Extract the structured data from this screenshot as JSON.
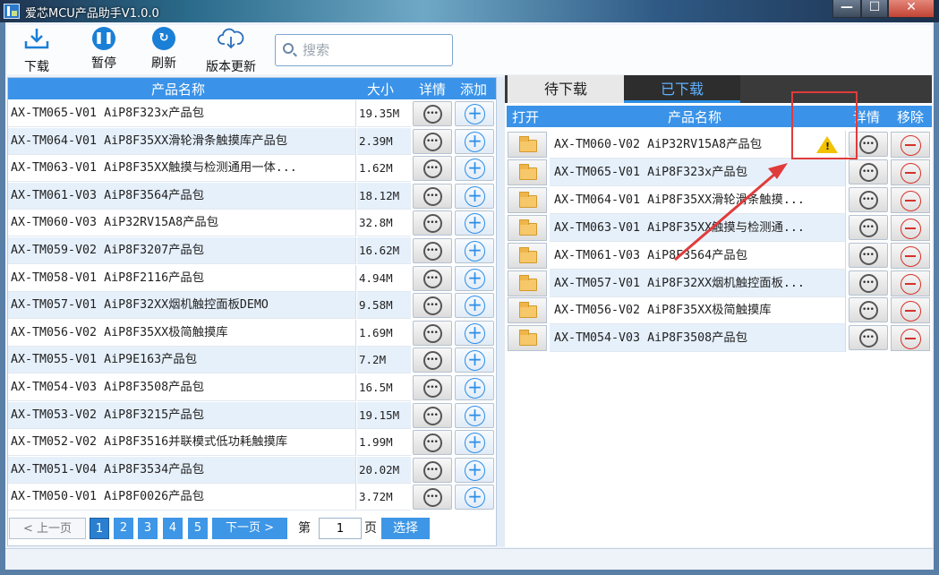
{
  "window": {
    "title": "爱芯MCU产品助手V1.0.0",
    "min": "—",
    "max": "☐",
    "close": "✕"
  },
  "toolbar": {
    "download": "下载",
    "pause": "暂停",
    "refresh": "刷新",
    "update": "版本更新",
    "search_placeholder": "搜索"
  },
  "left_table": {
    "headers": {
      "name": "产品名称",
      "size": "大小",
      "detail": "详情",
      "add": "添加"
    },
    "rows": [
      {
        "name": "AX-TM065-V01 AiP8F323x产品包",
        "size": "19.35M"
      },
      {
        "name": "AX-TM064-V01 AiP8F35XX滑轮滑条触摸库产品包",
        "size": "2.39M"
      },
      {
        "name": "AX-TM063-V01 AiP8F35XX触摸与检测通用一体...",
        "size": "1.62M"
      },
      {
        "name": "AX-TM061-V03 AiP8F3564产品包",
        "size": "18.12M"
      },
      {
        "name": "AX-TM060-V03 AiP32RV15A8产品包",
        "size": "32.8M"
      },
      {
        "name": "AX-TM059-V02 AiP8F3207产品包",
        "size": "16.62M"
      },
      {
        "name": "AX-TM058-V01 AiP8F2116产品包",
        "size": "4.94M"
      },
      {
        "name": "AX-TM057-V01 AiP8F32XX烟机触控面板DEMO",
        "size": "9.58M"
      },
      {
        "name": "AX-TM056-V02 AiP8F35XX极简触摸库",
        "size": "1.69M"
      },
      {
        "name": "AX-TM055-V01 AiP9E163产品包",
        "size": "7.2M"
      },
      {
        "name": "AX-TM054-V03 AiP8F3508产品包",
        "size": "16.5M"
      },
      {
        "name": "AX-TM053-V02 AiP8F3215产品包",
        "size": "19.15M"
      },
      {
        "name": "AX-TM052-V02 AiP8F3516并联模式低功耗触摸库",
        "size": "1.99M"
      },
      {
        "name": "AX-TM051-V04 AiP8F3534产品包",
        "size": "20.02M"
      },
      {
        "name": "AX-TM050-V01 AiP8F0026产品包",
        "size": "3.72M"
      }
    ]
  },
  "pagination": {
    "prev": "< 上一页",
    "pages": [
      "1",
      "2",
      "3",
      "4",
      "5"
    ],
    "current_page": "1",
    "next": "下一页 >",
    "goto_prefix": "第",
    "goto_value": "1",
    "goto_suffix": "页",
    "goto_button": "选择"
  },
  "right_panel": {
    "tabs": {
      "pending": "待下载",
      "downloaded": "已下载"
    },
    "headers": {
      "open": "打开",
      "name": "产品名称",
      "detail": "详情",
      "remove": "移除"
    },
    "rows": [
      {
        "name": "AX-TM060-V02 AiP32RV15A8产品包",
        "warning": true
      },
      {
        "name": "AX-TM065-V01 AiP8F323x产品包"
      },
      {
        "name": "AX-TM064-V01 AiP8F35XX滑轮滑条触摸..."
      },
      {
        "name": "AX-TM063-V01 AiP8F35XX触摸与检测通..."
      },
      {
        "name": "AX-TM061-V03 AiP8F3564产品包"
      },
      {
        "name": "AX-TM057-V01 AiP8F32XX烟机触控面板..."
      },
      {
        "name": "AX-TM056-V02 AiP8F35XX极简触摸库"
      },
      {
        "name": "AX-TM054-V03 AiP8F3508产品包"
      }
    ]
  },
  "colors": {
    "accent": "#3a93e8",
    "annotation": "#e03b3b",
    "warning": "#f2c200"
  }
}
